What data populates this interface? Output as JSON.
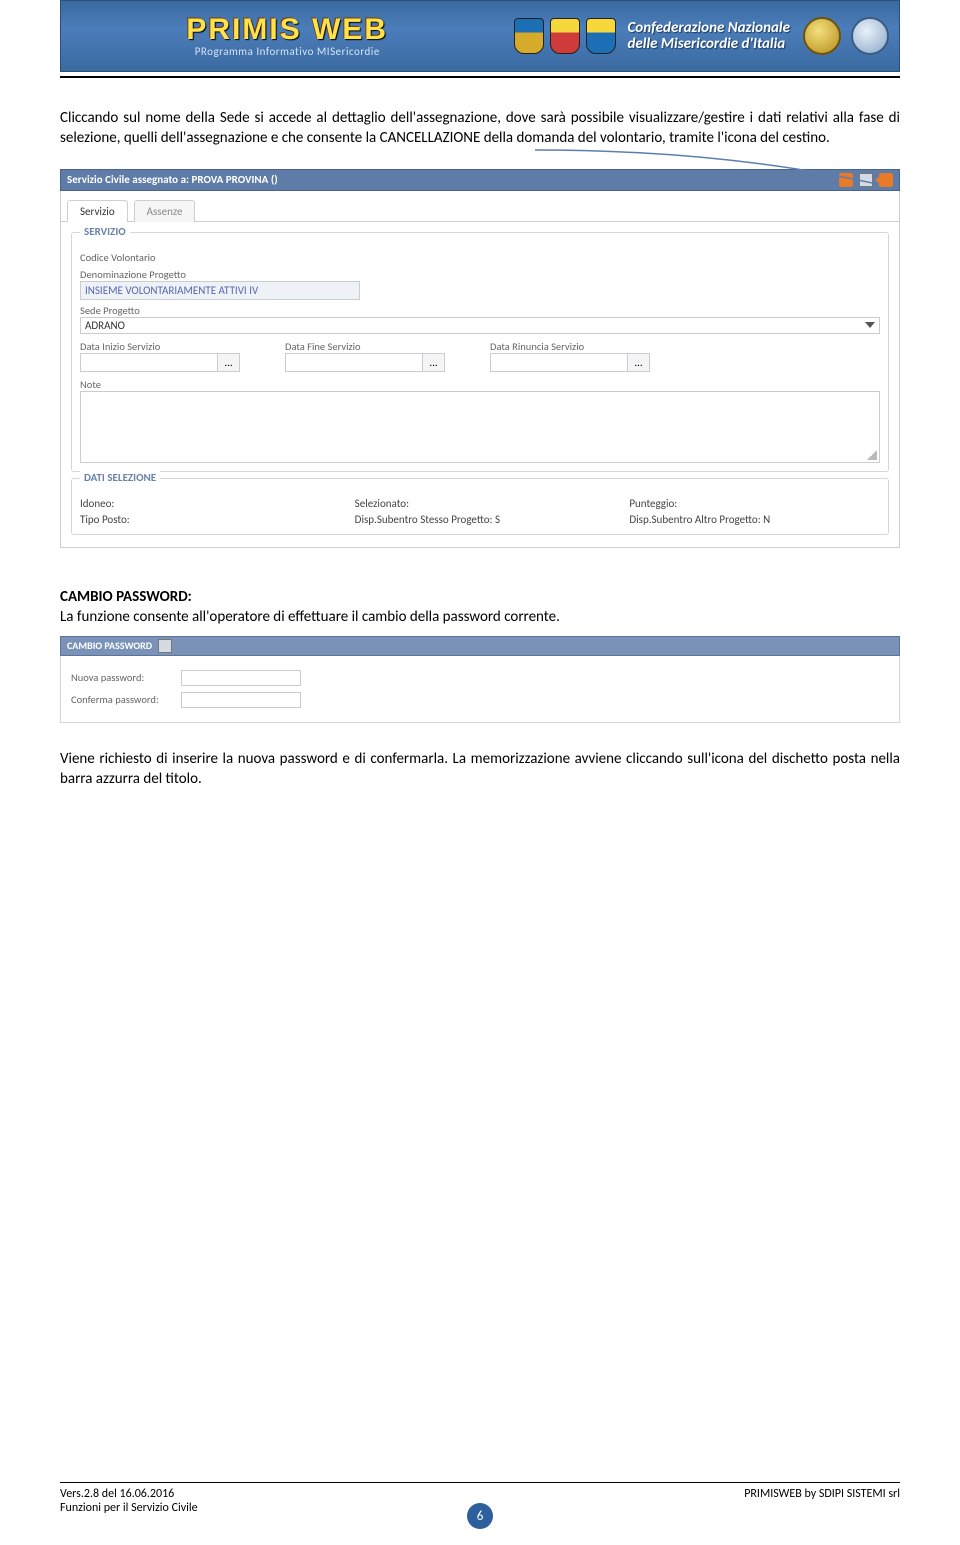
{
  "banner": {
    "title": "PRIMIS WEB",
    "subtitle": "PRogramma Informativo MISericordie",
    "right_line1": "Confederazione Nazionale",
    "right_line2": "delle Misericordie d'Italia"
  },
  "paragraph1": "Cliccando sul nome della Sede si accede al dettaglio dell'assegnazione, dove sarà possibile visualizzare/gestire i dati relativi alla fase di selezione, quelli dell'assegnazione e che consente la CANCELLAZIONE della domanda del volontario, tramite l'icona del cestino.",
  "form": {
    "titlebar": "Servizio Civile assegnato a: PROVA PROVINA ()",
    "tab_servizio": "Servizio",
    "tab_assenze": "Assenze",
    "legend_servizio": "SERVIZIO",
    "lbl_codice": "Codice Volontario",
    "lbl_denom": "Denominazione Progetto",
    "val_denom": "INSIEME VOLONTARIAMENTE ATTIVI IV",
    "lbl_sede": "Sede Progetto",
    "val_sede": "ADRANO",
    "lbl_inizio": "Data Inizio Servizio",
    "lbl_fine": "Data Fine Servizio",
    "lbl_rinuncia": "Data Rinuncia Servizio",
    "lbl_note": "Note",
    "legend_dati": "DATI SELEZIONE",
    "ds_idoneo": "Idoneo:",
    "ds_selez": "Selezionato:",
    "ds_punt": "Punteggio:",
    "ds_tipo": "Tipo Posto:",
    "ds_disp_s": "Disp.Subentro Stesso Progetto: S",
    "ds_disp_a": "Disp.Subentro Altro Progetto: N"
  },
  "cambio": {
    "heading": "CAMBIO PASSWORD:",
    "desc": "La funzione consente all'operatore di effettuare il cambio della password corrente.",
    "titlebar": "CAMBIO PASSWORD",
    "nuova": "Nuova password:",
    "conferma": "Conferma password:",
    "para_after": "Viene richiesto di inserire la nuova password e di confermarla. La memorizzazione avviene cliccando sull'icona del dischetto posta nella barra azzurra del titolo."
  },
  "footer": {
    "version": "Vers.2.8 del 16.06.2016",
    "subtitle": "Funzioni per il Servizio Civile",
    "right": "PRIMISWEB by SDIPI SISTEMI srl",
    "page": "6"
  }
}
